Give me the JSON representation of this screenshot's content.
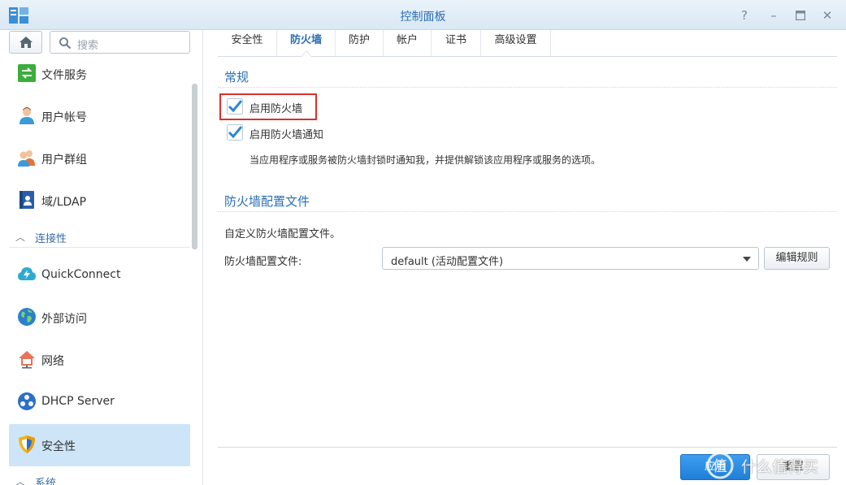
{
  "window": {
    "title": "控制面板",
    "buttons": [
      "help-icon",
      "minimize-icon",
      "maximize-icon",
      "close-icon"
    ]
  },
  "sidebar": {
    "search_placeholder": "搜索",
    "items_top": [
      {
        "label": "文件服务",
        "icon": "file-services-icon"
      },
      {
        "label": "用户帐号",
        "icon": "user-icon"
      },
      {
        "label": "用户群组",
        "icon": "user-group-icon"
      },
      {
        "label": "域/LDAP",
        "icon": "domain-ldap-icon"
      }
    ],
    "section_connectivity": "连接性",
    "items_conn": [
      {
        "label": "QuickConnect",
        "icon": "quickconnect-icon"
      },
      {
        "label": "外部访问",
        "icon": "external-access-icon"
      },
      {
        "label": "网络",
        "icon": "network-icon"
      },
      {
        "label": "DHCP Server",
        "icon": "dhcp-server-icon"
      },
      {
        "label": "安全性",
        "icon": "security-shield-icon"
      }
    ],
    "section_system": "系统"
  },
  "tabs": [
    "安全性",
    "防火墙",
    "防护",
    "帐户",
    "证书",
    "高级设置"
  ],
  "active_tab": "防火墙",
  "general": {
    "title": "常规",
    "enable_firewall": {
      "label": "启用防火墙",
      "checked": true
    },
    "enable_notify": {
      "label": "启用防火墙通知",
      "checked": true
    },
    "notify_desc": "当应用程序或服务被防火墙封锁时通知我，并提供解锁该应用程序或服务的选项。"
  },
  "profile": {
    "title": "防火墙配置文件",
    "desc": "自定义防火墙配置文件。",
    "field_label": "防火墙配置文件:",
    "selected": "default (活动配置文件)",
    "edit_button": "编辑规则"
  },
  "footer": {
    "apply_button": "应用",
    "reset_button": "重置",
    "watermark": "什么值得买"
  },
  "colors": {
    "accent": "#2a6fb6",
    "active_bg": "#cde5f7",
    "highlight_border": "#d9312c",
    "checkbox_blue": "#2b87d8"
  }
}
